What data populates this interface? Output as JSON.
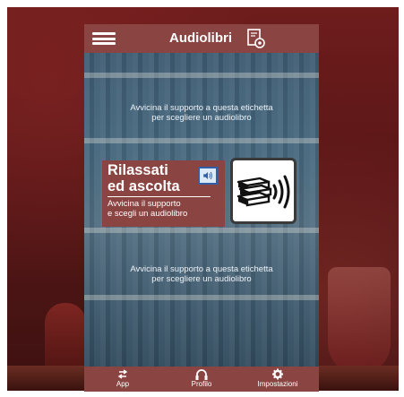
{
  "header": {
    "title": "Audiolibri",
    "menu_icon": "hamburger-menu-icon",
    "action_icon": "audiobook-settings-icon"
  },
  "hints": {
    "top": {
      "line1": "Avvicina il supporto a questa etichetta",
      "line2": "per scegliere un audiolibro"
    },
    "bottom": {
      "line1": "Avvicina il supporto a questa etichetta",
      "line2": "per scegliere un audiolibro"
    }
  },
  "card": {
    "title": "Rilassati\ned ascolta",
    "description": "Avvicina il supporto\ne scegli un audiolibro",
    "icon": "speaker-icon"
  },
  "nfc_tag": {
    "icon": "books-nfc-icon"
  },
  "bottom_nav": {
    "items": [
      {
        "label": "App",
        "icon": "arrows-swap-icon"
      },
      {
        "label": "Profilo",
        "icon": "headphones-icon"
      },
      {
        "label": "Impostazioni",
        "icon": "gear-icon"
      }
    ]
  },
  "colors": {
    "bar": "#8a4442",
    "outer_background": "#5a1717",
    "text": "#ffffff"
  }
}
